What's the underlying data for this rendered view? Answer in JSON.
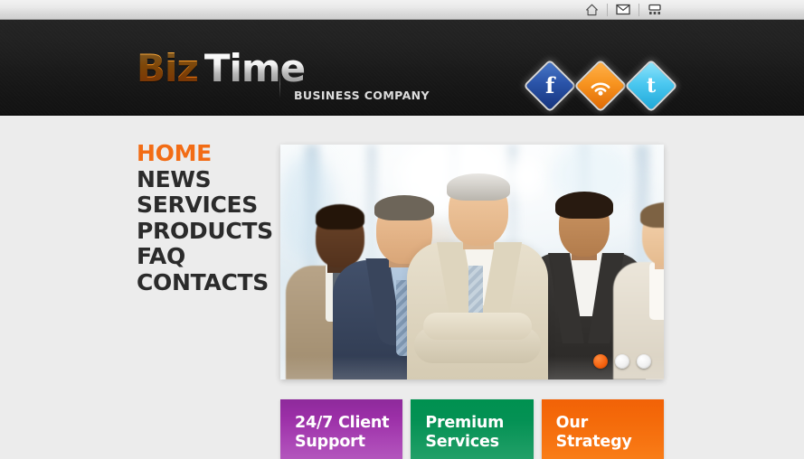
{
  "topbar": {
    "icons": [
      {
        "name": "home-icon",
        "label": "Home"
      },
      {
        "name": "mail-icon",
        "label": "Mail"
      },
      {
        "name": "sitemap-icon",
        "label": "Sitemap"
      }
    ]
  },
  "header": {
    "logo_primary": "Biz",
    "logo_secondary": "Time",
    "tagline": "BUSINESS COMPANY",
    "socials": [
      {
        "name": "facebook-icon",
        "glyph": "f",
        "label": "Facebook"
      },
      {
        "name": "rss-icon",
        "glyph": "",
        "label": "RSS"
      },
      {
        "name": "twitter-icon",
        "glyph": "t",
        "label": "Twitter"
      }
    ]
  },
  "nav": {
    "items": [
      {
        "label": "HOME",
        "active": true
      },
      {
        "label": "NEWS",
        "active": false
      },
      {
        "label": "SERVICES",
        "active": false
      },
      {
        "label": "PRODUCTS",
        "active": false
      },
      {
        "label": "FAQ",
        "active": false
      },
      {
        "label": "CONTACTS",
        "active": false
      }
    ]
  },
  "slider": {
    "alt": "Business team of five professionals standing in a bright office",
    "dots": [
      {
        "active": true
      },
      {
        "active": false
      },
      {
        "active": false
      }
    ]
  },
  "promos": [
    {
      "line1": "24/7 Client",
      "line2": "Support",
      "color": "#9b2fa7"
    },
    {
      "line1": "Premium",
      "line2": "Services",
      "color": "#009150"
    },
    {
      "line1": "Our",
      "line2": "Strategy",
      "color": "#f26207"
    }
  ],
  "colors": {
    "accent_orange": "#f26c15",
    "header_dark": "#1a1a1a",
    "body_bg": "#ececec"
  }
}
